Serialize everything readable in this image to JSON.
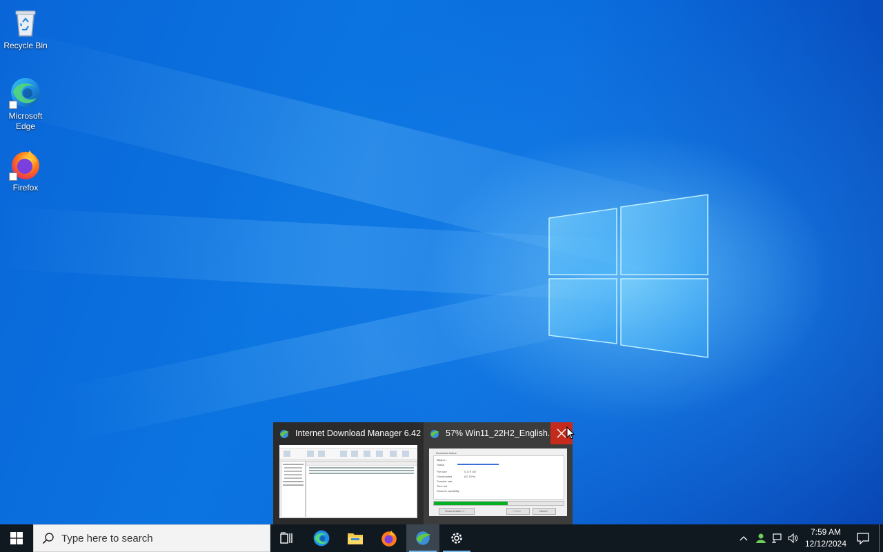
{
  "desktop": {
    "icons": [
      {
        "label": "Recycle Bin",
        "icon": "recycle-bin-icon"
      },
      {
        "label": "Microsoft Edge",
        "icon": "edge-icon"
      },
      {
        "label": "Firefox",
        "icon": "firefox-icon"
      }
    ]
  },
  "thumbnails": {
    "items": [
      {
        "title": "Internet Download Manager 6.42",
        "icon": "idm-icon"
      },
      {
        "title": "57% Win11_22H2_English...",
        "icon": "idm-icon",
        "preview": {
          "group_label": "Download status",
          "url": "https://...",
          "status_label": "Status",
          "rows": [
            {
              "label": "File size",
              "value": "5.179 GB"
            },
            {
              "label": "Downloaded",
              "value": "(57.00%)"
            },
            {
              "label": "Transfer rate",
              "value": ""
            },
            {
              "label": "Time left",
              "value": ""
            },
            {
              "label": "Resume capability",
              "value": ""
            }
          ],
          "progress": 0.57,
          "show_details_label": "Show details >>",
          "pause_label": "Pause",
          "cancel_label": "Cancel"
        }
      }
    ],
    "close_icon": "close-icon"
  },
  "taskbar": {
    "search_placeholder": "Type here to search",
    "pinned": [
      "task-view-icon",
      "edge-icon",
      "file-explorer-icon",
      "firefox-icon",
      "idm-icon",
      "settings-icon"
    ],
    "tray": {
      "time": "7:59 AM",
      "date": "12/12/2024"
    }
  },
  "colors": {
    "accent": "#76b9ed",
    "close_red": "#c42b1c",
    "taskbar_bg": "#101820"
  }
}
